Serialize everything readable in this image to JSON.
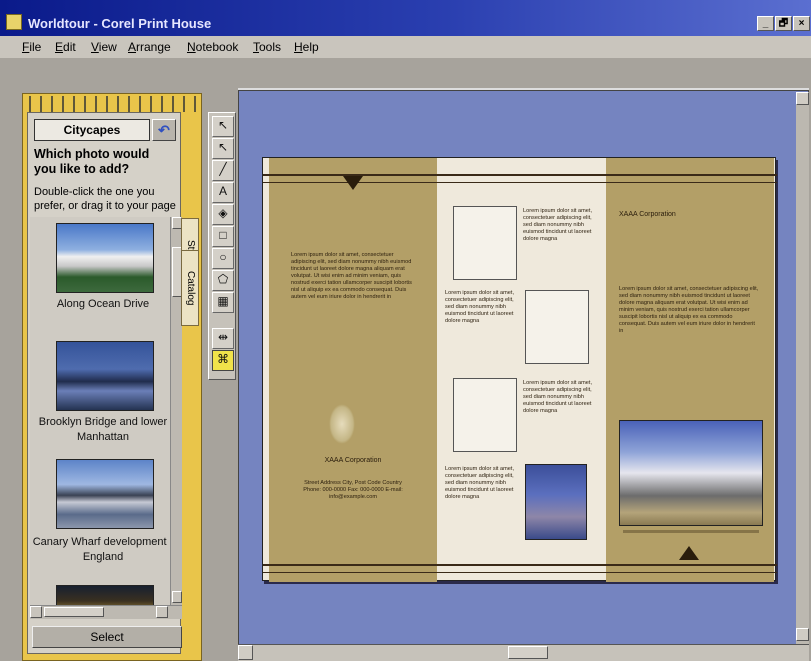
{
  "window": {
    "title": "Worldtour - Corel Print House",
    "controls": [
      "_",
      "🗗",
      "×"
    ]
  },
  "menu": {
    "items": [
      {
        "label": "File",
        "key": "F",
        "rest": "ile"
      },
      {
        "label": "Edit",
        "key": "E",
        "rest": "dit"
      },
      {
        "label": "View",
        "key": "V",
        "rest": "iew"
      },
      {
        "label": "Arrange",
        "key": "A",
        "rest": "rrange"
      },
      {
        "label": "Notebook",
        "key": "N",
        "rest": "otebook"
      },
      {
        "label": "Tools",
        "key": "T",
        "rest": "ools"
      },
      {
        "label": "Help",
        "key": "H",
        "rest": "elp"
      }
    ]
  },
  "notebook": {
    "category": "Citycapes",
    "question": "Which photo would you like to add?",
    "instructions": "Double-click the one you prefer, or drag it to your page",
    "tabs": [
      "Styles",
      "Catalog"
    ],
    "photos": [
      {
        "label": "Along Ocean Drive",
        "icon": "photo-thumbnail"
      },
      {
        "label": "Brooklyn Bridge and lower Manhattan",
        "icon": "photo-thumbnail"
      },
      {
        "label": "Canary Wharf development - England",
        "icon": "photo-thumbnail"
      },
      {
        "label": "",
        "icon": "photo-thumbnail"
      }
    ],
    "select_button": "Select"
  },
  "toolbox": {
    "tools": [
      {
        "name": "pointer-tool",
        "glyph": "↖"
      },
      {
        "name": "pick-tool",
        "glyph": "↖"
      },
      {
        "name": "line-tool",
        "glyph": "╱"
      },
      {
        "name": "text-tool",
        "glyph": "A"
      },
      {
        "name": "fill-tool",
        "glyph": "◈"
      },
      {
        "name": "rectangle-tool",
        "glyph": "□"
      },
      {
        "name": "ellipse-tool",
        "glyph": "○"
      },
      {
        "name": "polygon-tool",
        "glyph": "⬠"
      },
      {
        "name": "table-tool",
        "glyph": "▦"
      },
      {
        "name": "fold-tool",
        "glyph": "⇹"
      },
      {
        "name": "brochure-tool",
        "glyph": "⌘"
      }
    ]
  },
  "brochure": {
    "lorem_short": "Lorem ipsum dolor sit amet, consectetuer adipiscing elit, sed diam nonummy nibh euismod tincidunt ut laoreet dolore magna",
    "lorem_long": "Lorem ipsum dolor sit amet, consectetuer adipiscing elit, sed diam nonummy nibh euismod tincidunt ut laoreet dolore magna aliquam erat volutpat. Ut wisi enim ad minim veniam, quis nostrud exerci tation ullamcorper suscipit lobortis nisl ut aliquip ex ea commodo consequat. Duis autem vel eum iriure dolor in hendrerit in",
    "company_heading": "XAAA Corporation",
    "company_address": "Street Address City, Post Code Country Phone: 000-0000 Fax: 000-0000 E-mail: info@example.com",
    "right_heading": "XAAA Corporation"
  },
  "colors": {
    "title_bar": "#0a1a8a",
    "notebook": "#e9c54a",
    "canvas": "#7584c0",
    "brochure_tan": "#b39f67"
  }
}
